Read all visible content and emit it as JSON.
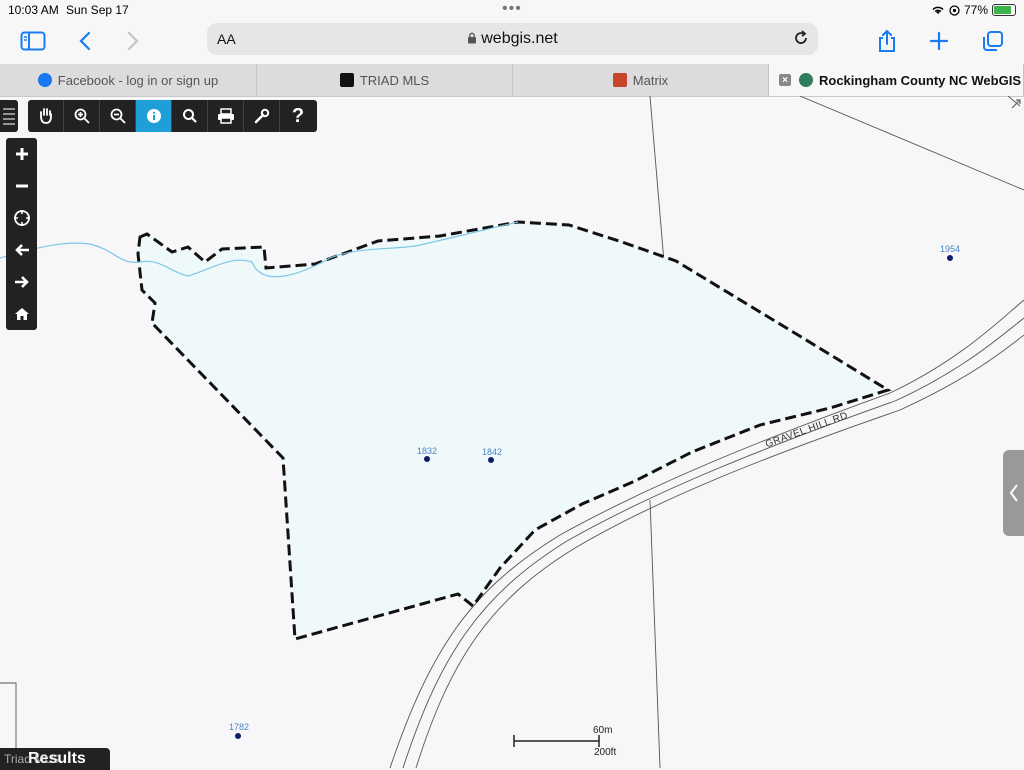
{
  "status": {
    "time": "10:03 AM",
    "date": "Sun Sep 17",
    "battery": "77%",
    "battery_level": 0.77
  },
  "browser": {
    "text_size_label": "AA",
    "url": "webgis.net",
    "tabs": [
      {
        "label": "Facebook - log in or sign up",
        "icon": "facebook-icon"
      },
      {
        "label": "TRIAD MLS",
        "icon": "triad-mls-icon"
      },
      {
        "label": "Matrix",
        "icon": "matrix-icon"
      },
      {
        "label": "Rockingham County NC WebGIS",
        "icon": "webgis-icon"
      }
    ]
  },
  "map": {
    "address_labels": [
      "1832",
      "1842",
      "1954",
      "1782"
    ],
    "road_label": "GRAVEL HILL RD",
    "scale_metric": "60m",
    "scale_imperial": "200ft",
    "results_label": "Results",
    "watermark": "Triad MLS",
    "parcel_fill": "#f0f9f9",
    "stream_color": "#7fc6e6",
    "active_tool_color": "#1f9fd8"
  }
}
